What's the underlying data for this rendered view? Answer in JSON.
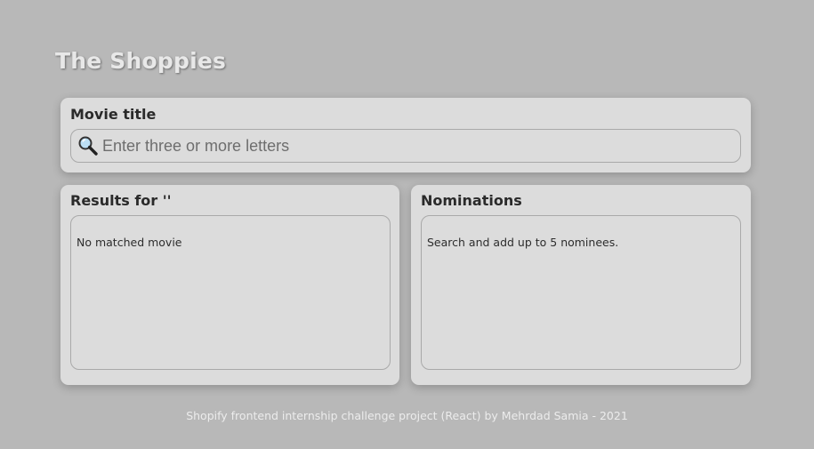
{
  "app": {
    "title": "The Shoppies"
  },
  "search": {
    "label": "Movie title",
    "placeholder": "Enter three or more letters",
    "value": "",
    "icon": "search-icon"
  },
  "results": {
    "title": "Results for ''",
    "empty_text": "No matched movie"
  },
  "nominations": {
    "title": "Nominations",
    "empty_text": "Search and add up to 5 nominees."
  },
  "footer": {
    "text": "Shopify frontend internship challenge project (React) by Mehrdad Samia - 2021"
  },
  "colors": {
    "background": "#b8b8b8",
    "card": "#dcdcdc",
    "border": "#a9a9a9",
    "title_text": "#e8e8e8",
    "footer_text": "#ececec"
  }
}
